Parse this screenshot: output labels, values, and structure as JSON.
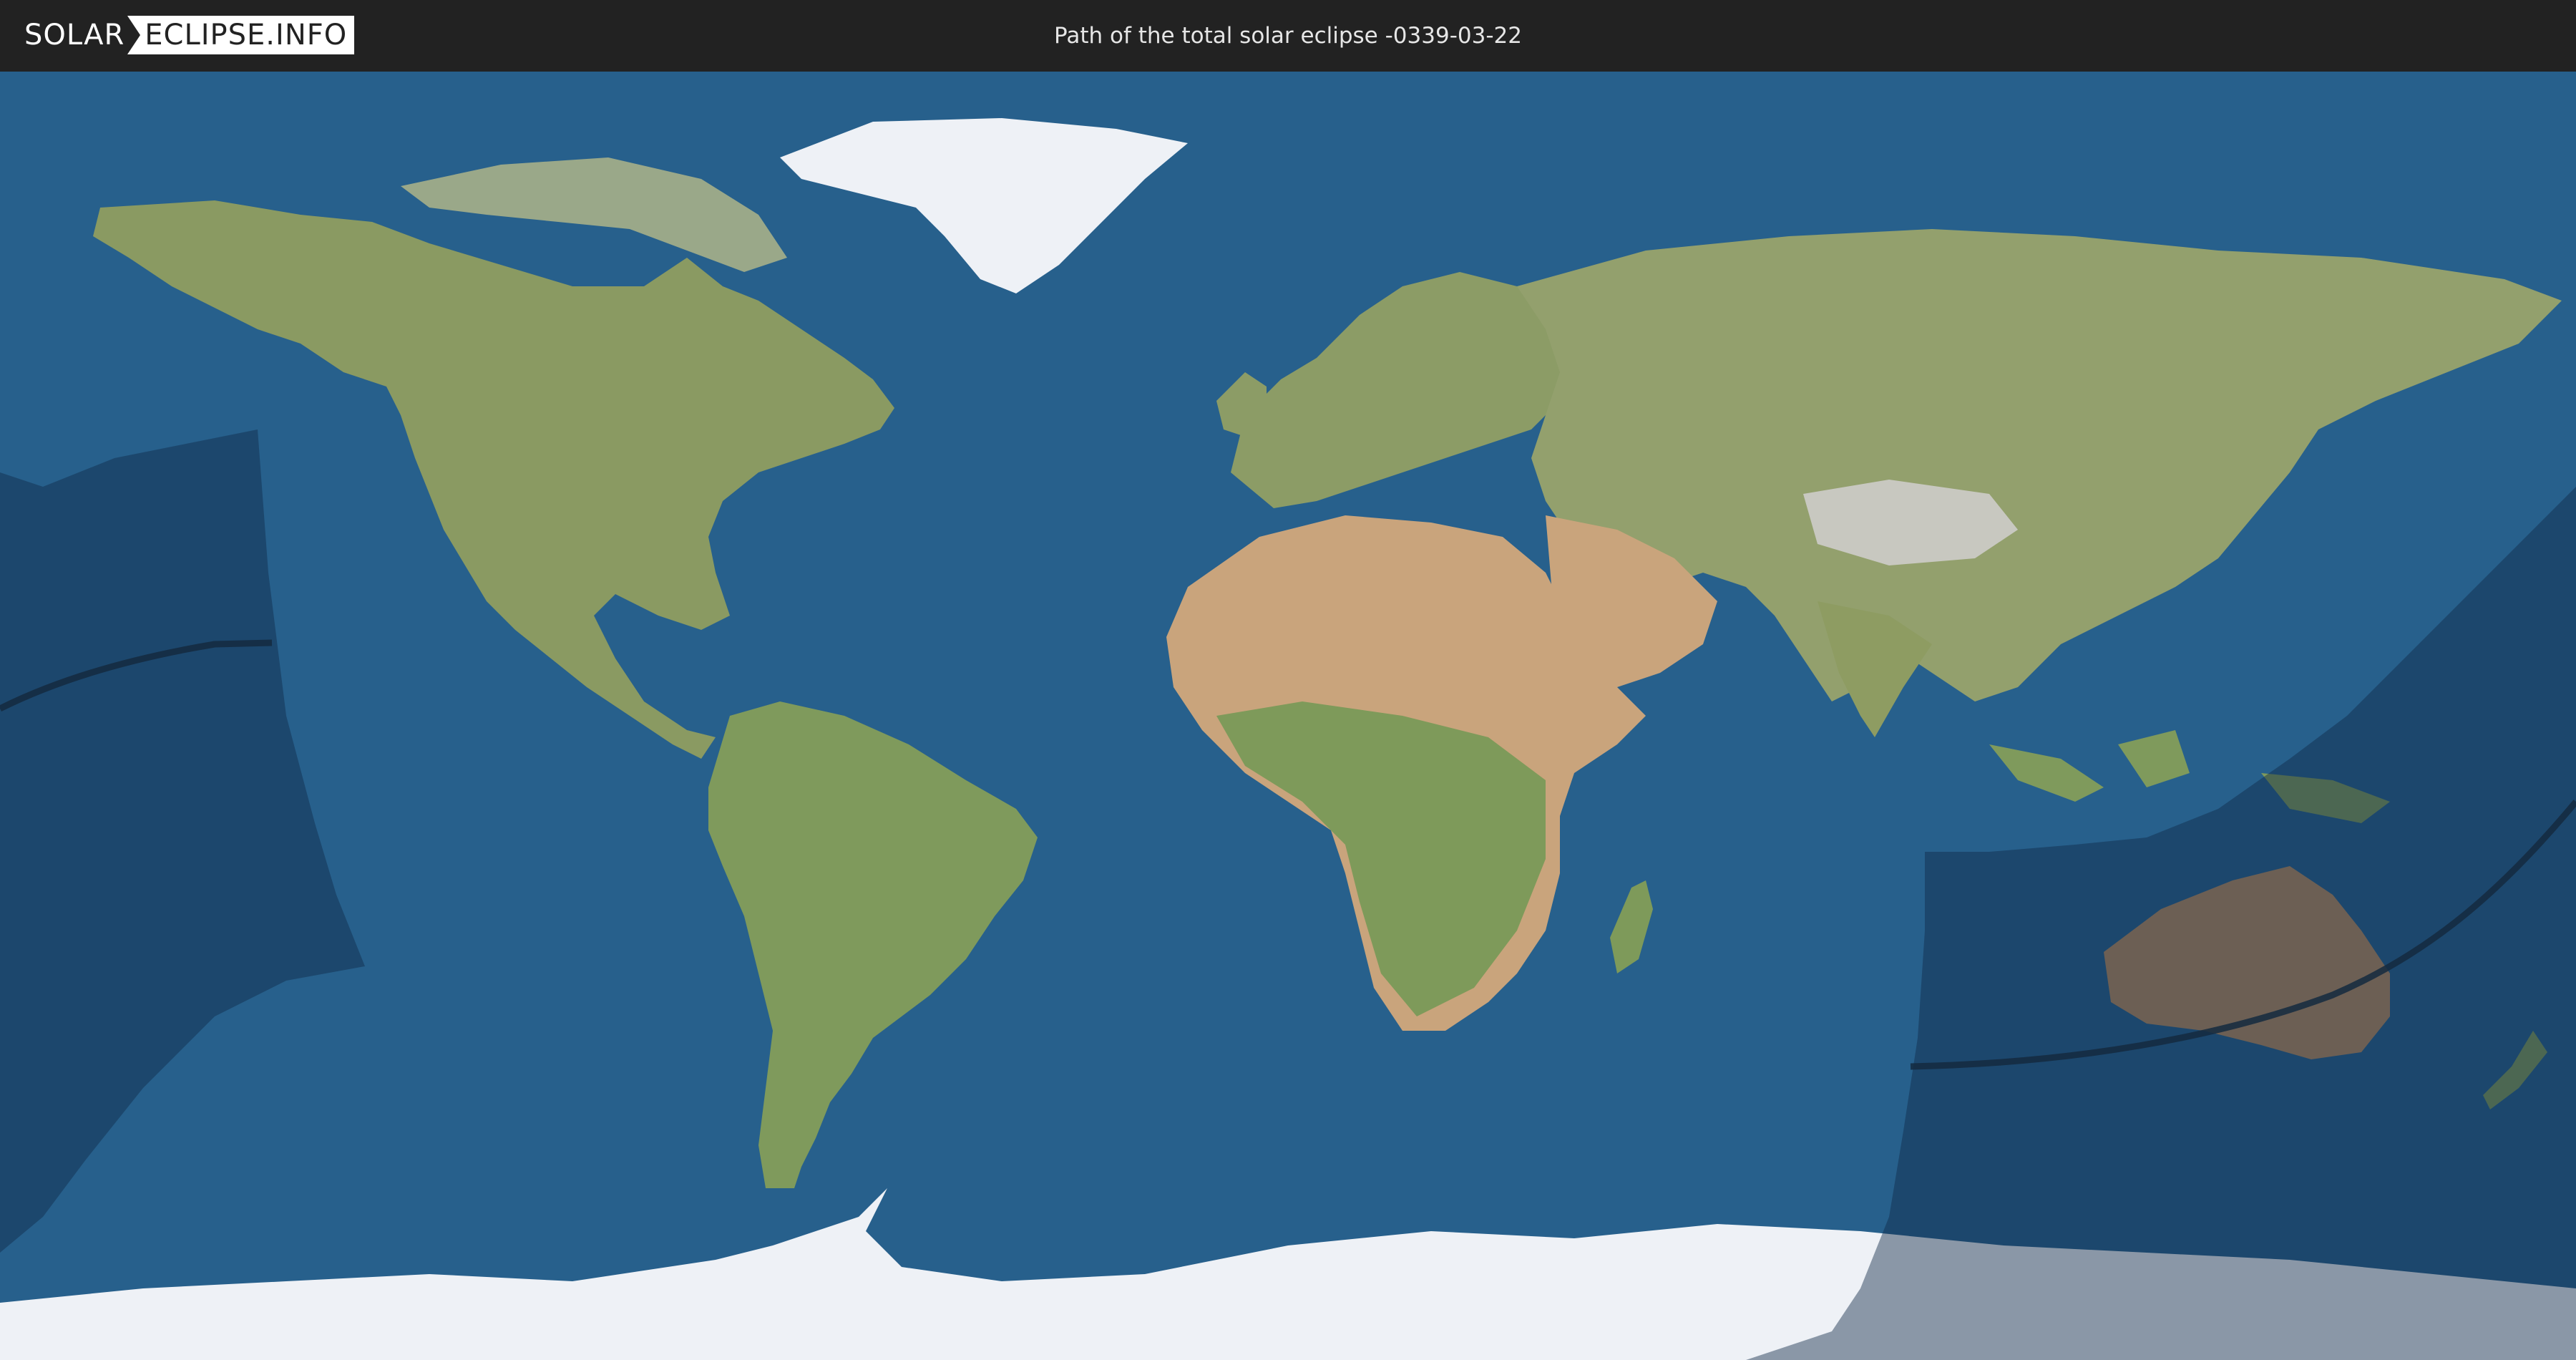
{
  "header": {
    "logo_part1": "SOLAR",
    "logo_part2": "ECLIPSE.INFO",
    "title": "Path of the total solar eclipse -0339-03-22"
  },
  "colors": {
    "ocean": "#27608c",
    "land": "#8f9c66",
    "desert": "#c9a47c",
    "ice": "#e8ecf2",
    "shadow": "#0f2a48",
    "path_line": "#142a40",
    "header_bg": "#222222"
  }
}
